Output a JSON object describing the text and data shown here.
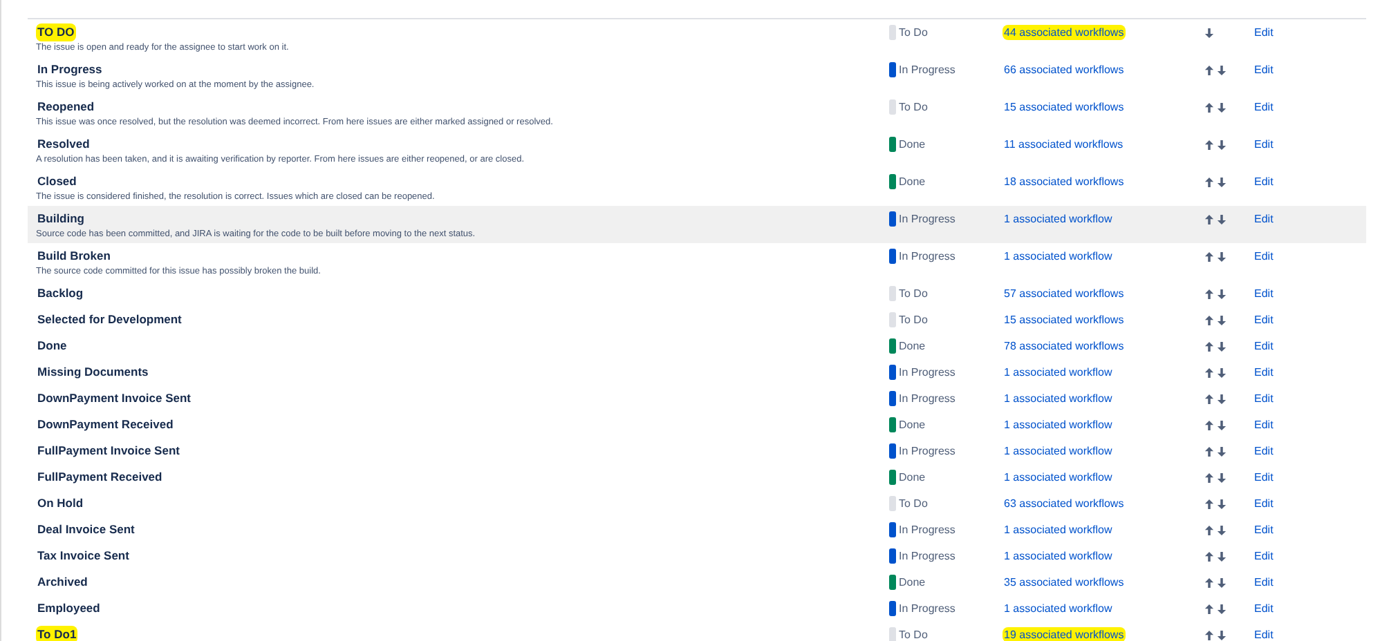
{
  "rows": [
    {
      "name": "TO DO",
      "name_highlighted": true,
      "description": "The issue is open and ready for the assignee to start work on it.",
      "category": {
        "label": "To Do",
        "color": "#dfe1e6"
      },
      "workflows": "44 associated workflows",
      "workflows_highlighted": true,
      "hovered": false,
      "move_up": false,
      "move_down": true,
      "action": "Edit"
    },
    {
      "name": "In Progress",
      "name_highlighted": false,
      "description": "This issue is being actively worked on at the moment by the assignee.",
      "category": {
        "label": "In Progress",
        "color": "#0052cc"
      },
      "workflows": "66 associated workflows",
      "workflows_highlighted": false,
      "hovered": false,
      "move_up": true,
      "move_down": true,
      "action": "Edit"
    },
    {
      "name": "Reopened",
      "name_highlighted": false,
      "description": "This issue was once resolved, but the resolution was deemed incorrect. From here issues are either marked assigned or resolved.",
      "category": {
        "label": "To Do",
        "color": "#dfe1e6"
      },
      "workflows": "15 associated workflows",
      "workflows_highlighted": false,
      "hovered": false,
      "move_up": true,
      "move_down": true,
      "action": "Edit"
    },
    {
      "name": "Resolved",
      "name_highlighted": false,
      "description": "A resolution has been taken, and it is awaiting verification by reporter. From here issues are either reopened, or are closed.",
      "category": {
        "label": "Done",
        "color": "#00875a"
      },
      "workflows": "11 associated workflows",
      "workflows_highlighted": false,
      "hovered": false,
      "move_up": true,
      "move_down": true,
      "action": "Edit"
    },
    {
      "name": "Closed",
      "name_highlighted": false,
      "description": "The issue is considered finished, the resolution is correct. Issues which are closed can be reopened.",
      "category": {
        "label": "Done",
        "color": "#00875a"
      },
      "workflows": "18 associated workflows",
      "workflows_highlighted": false,
      "hovered": false,
      "move_up": true,
      "move_down": true,
      "action": "Edit"
    },
    {
      "name": "Building",
      "name_highlighted": false,
      "description": "Source code has been committed, and JIRA is waiting for the code to be built before moving to the next status.",
      "category": {
        "label": "In Progress",
        "color": "#0052cc"
      },
      "workflows": "1 associated workflow",
      "workflows_highlighted": false,
      "hovered": true,
      "move_up": true,
      "move_down": true,
      "action": "Edit"
    },
    {
      "name": "Build Broken",
      "name_highlighted": false,
      "description": "The source code committed for this issue has possibly broken the build.",
      "category": {
        "label": "In Progress",
        "color": "#0052cc"
      },
      "workflows": "1 associated workflow",
      "workflows_highlighted": false,
      "hovered": false,
      "move_up": true,
      "move_down": true,
      "action": "Edit"
    },
    {
      "name": "Backlog",
      "name_highlighted": false,
      "category": {
        "label": "To Do",
        "color": "#dfe1e6"
      },
      "workflows": "57 associated workflows",
      "workflows_highlighted": false,
      "hovered": false,
      "move_up": true,
      "move_down": true,
      "action": "Edit"
    },
    {
      "name": "Selected for Development",
      "name_highlighted": false,
      "category": {
        "label": "To Do",
        "color": "#dfe1e6"
      },
      "workflows": "15 associated workflows",
      "workflows_highlighted": false,
      "hovered": false,
      "move_up": true,
      "move_down": true,
      "action": "Edit"
    },
    {
      "name": "Done",
      "name_highlighted": false,
      "category": {
        "label": "Done",
        "color": "#00875a"
      },
      "workflows": "78 associated workflows",
      "workflows_highlighted": false,
      "hovered": false,
      "move_up": true,
      "move_down": true,
      "action": "Edit"
    },
    {
      "name": "Missing Documents",
      "name_highlighted": false,
      "category": {
        "label": "In Progress",
        "color": "#0052cc"
      },
      "workflows": "1 associated workflow",
      "workflows_highlighted": false,
      "hovered": false,
      "move_up": true,
      "move_down": true,
      "action": "Edit"
    },
    {
      "name": "DownPayment Invoice Sent",
      "name_highlighted": false,
      "category": {
        "label": "In Progress",
        "color": "#0052cc"
      },
      "workflows": "1 associated workflow",
      "workflows_highlighted": false,
      "hovered": false,
      "move_up": true,
      "move_down": true,
      "action": "Edit"
    },
    {
      "name": "DownPayment Received",
      "name_highlighted": false,
      "category": {
        "label": "Done",
        "color": "#00875a"
      },
      "workflows": "1 associated workflow",
      "workflows_highlighted": false,
      "hovered": false,
      "move_up": true,
      "move_down": true,
      "action": "Edit"
    },
    {
      "name": "FullPayment Invoice Sent",
      "name_highlighted": false,
      "category": {
        "label": "In Progress",
        "color": "#0052cc"
      },
      "workflows": "1 associated workflow",
      "workflows_highlighted": false,
      "hovered": false,
      "move_up": true,
      "move_down": true,
      "action": "Edit"
    },
    {
      "name": "FullPayment Received",
      "name_highlighted": false,
      "category": {
        "label": "Done",
        "color": "#00875a"
      },
      "workflows": "1 associated workflow",
      "workflows_highlighted": false,
      "hovered": false,
      "move_up": true,
      "move_down": true,
      "action": "Edit"
    },
    {
      "name": "On Hold",
      "name_highlighted": false,
      "category": {
        "label": "To Do",
        "color": "#dfe1e6"
      },
      "workflows": "63 associated workflows",
      "workflows_highlighted": false,
      "hovered": false,
      "move_up": true,
      "move_down": true,
      "action": "Edit"
    },
    {
      "name": "Deal Invoice Sent",
      "name_highlighted": false,
      "category": {
        "label": "In Progress",
        "color": "#0052cc"
      },
      "workflows": "1 associated workflow",
      "workflows_highlighted": false,
      "hovered": false,
      "move_up": true,
      "move_down": true,
      "action": "Edit"
    },
    {
      "name": "Tax Invoice Sent",
      "name_highlighted": false,
      "category": {
        "label": "In Progress",
        "color": "#0052cc"
      },
      "workflows": "1 associated workflow",
      "workflows_highlighted": false,
      "hovered": false,
      "move_up": true,
      "move_down": true,
      "action": "Edit"
    },
    {
      "name": "Archived",
      "name_highlighted": false,
      "category": {
        "label": "Done",
        "color": "#00875a"
      },
      "workflows": "35 associated workflows",
      "workflows_highlighted": false,
      "hovered": false,
      "move_up": true,
      "move_down": true,
      "action": "Edit"
    },
    {
      "name": "Employeed",
      "name_highlighted": false,
      "category": {
        "label": "In Progress",
        "color": "#0052cc"
      },
      "workflows": "1 associated workflow",
      "workflows_highlighted": false,
      "hovered": false,
      "move_up": true,
      "move_down": true,
      "action": "Edit"
    },
    {
      "name": "To Do1",
      "name_highlighted": true,
      "category": {
        "label": "To Do",
        "color": "#dfe1e6"
      },
      "workflows": "19 associated workflows",
      "workflows_highlighted": true,
      "hovered": false,
      "move_up": true,
      "move_down": true,
      "action": "Edit"
    }
  ]
}
